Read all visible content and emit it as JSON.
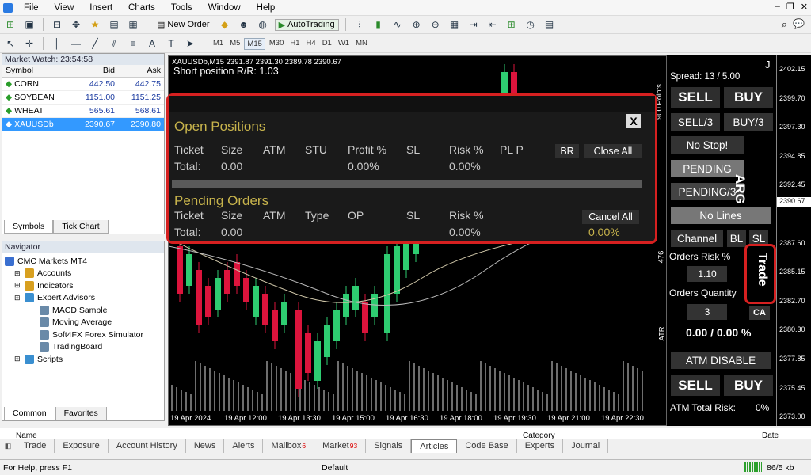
{
  "menu": [
    "File",
    "View",
    "Insert",
    "Charts",
    "Tools",
    "Window",
    "Help"
  ],
  "toolbar": {
    "new_order": "New Order",
    "autotrading": "AutoTrading",
    "timeframes": [
      "M1",
      "M5",
      "M15",
      "M30",
      "H1",
      "H4",
      "D1",
      "W1",
      "MN"
    ],
    "active_tf": "M15"
  },
  "market_watch": {
    "title": "Market Watch: 23:54:58",
    "cols": [
      "Symbol",
      "Bid",
      "Ask"
    ],
    "rows": [
      {
        "symbol": "CORN",
        "bid": "442.50",
        "ask": "442.75"
      },
      {
        "symbol": "SOYBEAN",
        "bid": "1151.00",
        "ask": "1151.25"
      },
      {
        "symbol": "WHEAT",
        "bid": "565.61",
        "ask": "568.61"
      },
      {
        "symbol": "XAUUSDb",
        "bid": "2390.67",
        "ask": "2390.80"
      }
    ],
    "tabs": [
      "Symbols",
      "Tick Chart"
    ]
  },
  "navigator": {
    "title": "Navigator",
    "root": "CMC Markets MT4",
    "items": [
      "Accounts",
      "Indicators",
      "Expert Advisors",
      "MACD Sample",
      "Moving Average",
      "Soft4FX Forex Simulator",
      "TradingBoard",
      "Scripts"
    ],
    "tabs": [
      "Common",
      "Favorites"
    ]
  },
  "chart": {
    "header": "XAUUSDb,M15  2391.87 2391.30 2389.78 2390.67",
    "rr": "Short position R/R: 1.03",
    "xaxis": [
      "19 Apr 2024",
      "19 Apr 12:00",
      "19 Apr 13:30",
      "19 Apr 15:00",
      "19 Apr 16:30",
      "19 Apr 18:00",
      "19 Apr 19:30",
      "19 Apr 21:00",
      "19 Apr 22:30"
    ],
    "yaxis": [
      "2402.15",
      "2399.70",
      "2397.30",
      "2394.85",
      "2392.45",
      "2390.00",
      "2387.60",
      "2385.15",
      "2382.70",
      "2380.30",
      "2377.85",
      "2375.45",
      "2373.00"
    ],
    "price_tag": "2390.67",
    "points_label": "900 Points",
    "atr_label": "ATR",
    "atr_val": "476"
  },
  "overlay": {
    "close": "X",
    "open_title": "Open Positions",
    "open_cols": [
      "Ticket",
      "Size",
      "ATM",
      "STU",
      "Profit %",
      "SL",
      "Risk %",
      "PL P"
    ],
    "open_total": {
      "label": "Total:",
      "size": "0.00",
      "profit": "0.00%",
      "risk": "0.00%"
    },
    "br": "BR",
    "close_all": "Close All",
    "pending_title": "Pending Orders",
    "pending_cols": [
      "Ticket",
      "Size",
      "ATM",
      "Type",
      "OP",
      "SL",
      "Risk %"
    ],
    "pending_total": {
      "label": "Total:",
      "size": "0.00",
      "risk": "0.00%",
      "extra": "0.00%"
    },
    "cancel_all": "Cancel All"
  },
  "right_panel": {
    "j": "J",
    "spread": "Spread: 13 / 5.00",
    "sell": "SELL",
    "buy": "BUY",
    "sell3": "SELL/3",
    "buy3": "BUY/3",
    "nostop": "No Stop!",
    "pending": "PENDING",
    "pending3": "PENDING/3",
    "nolines": "No Lines",
    "arg": "ARG",
    "channel": "Channel",
    "bl": "BL",
    "sl": "SL",
    "trade": "Trade",
    "orders_risk": "Orders Risk %",
    "risk_val": "1.10",
    "orders_qty": "Orders Quantity",
    "qty_val": "3",
    "ca": "CA",
    "pct": "0.00 / 0.00 %",
    "atm_disable": "ATM DISABLE",
    "sell2": "SELL",
    "buy2": "BUY",
    "atm_total": "ATM Total Risk:",
    "atm_total_val": "0%"
  },
  "bottom_tabs": [
    {
      "label": "Trade"
    },
    {
      "label": "Exposure"
    },
    {
      "label": "Account History"
    },
    {
      "label": "News"
    },
    {
      "label": "Alerts"
    },
    {
      "label": "Mailbox",
      "badge": "6"
    },
    {
      "label": "Market",
      "badge": "93"
    },
    {
      "label": "Signals"
    },
    {
      "label": "Articles",
      "active": true
    },
    {
      "label": "Code Base"
    },
    {
      "label": "Experts"
    },
    {
      "label": "Journal"
    }
  ],
  "terminal_header": {
    "name": "Name",
    "category": "Category",
    "date": "Date"
  },
  "status": {
    "help": "For Help, press F1",
    "profile": "Default",
    "traffic": "86/5 kb"
  },
  "colors": {
    "bull": "#2ecc71",
    "bear": "#dc143c",
    "accent": "#d62020"
  }
}
